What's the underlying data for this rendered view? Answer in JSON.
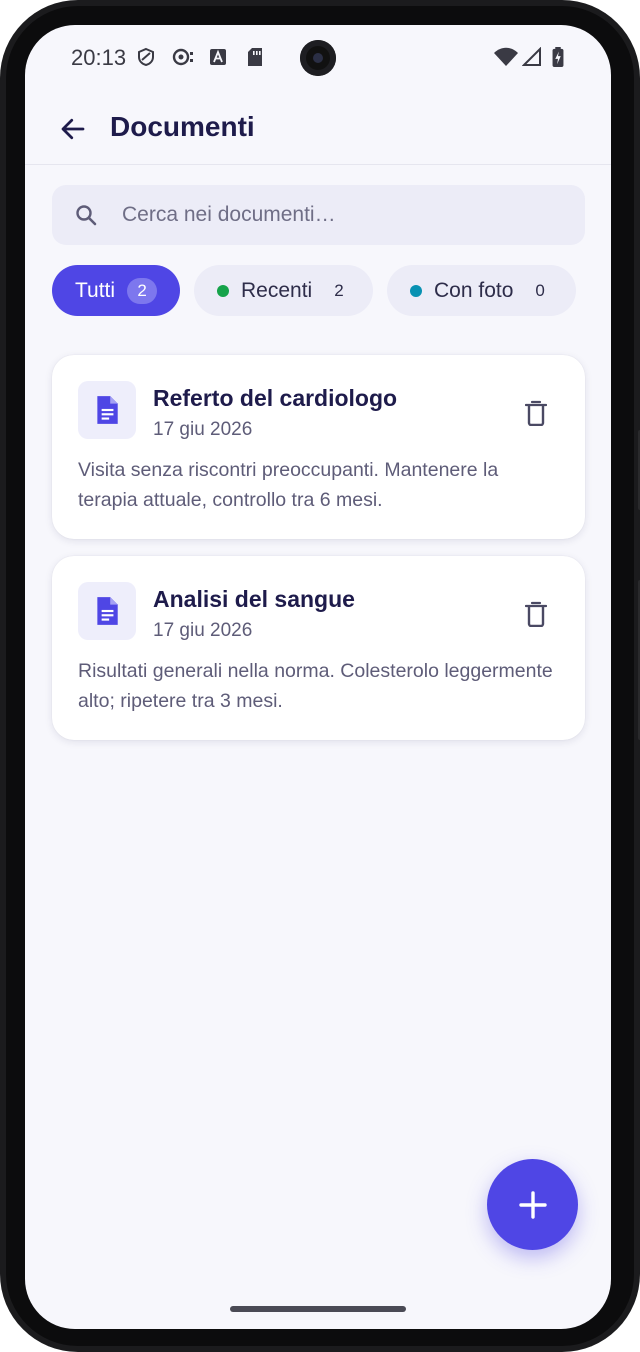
{
  "status_bar": {
    "time": "20:13",
    "icons": [
      "shield-icon",
      "tracking-icon",
      "keyboard-a-icon",
      "sd-card-icon",
      "wifi-icon",
      "signal-icon",
      "battery-charging-icon"
    ]
  },
  "appbar": {
    "title": "Documenti",
    "back_icon": "arrow-left-icon"
  },
  "search": {
    "placeholder": "Cerca nei documenti…",
    "value": "",
    "icon": "search-icon"
  },
  "filters": [
    {
      "label": "Tutti",
      "count": "2",
      "selected": true
    },
    {
      "label": "Recenti",
      "count": "2",
      "selected": false,
      "dot_color": "#16a34a"
    },
    {
      "label": "Con foto",
      "count": "0",
      "selected": false,
      "dot_color": "#0891b2"
    }
  ],
  "documents": [
    {
      "title": "Referto del cardiologo",
      "date": "17 giu 2026",
      "description": "Visita senza riscontri preoccupanti. Mantenere la terapia attuale, controllo tra 6 mesi.",
      "icon": "document-icon",
      "action_icon": "trash-icon"
    },
    {
      "title": "Analisi del sangue",
      "date": "17 giu 2026",
      "description": "Risultati generali nella norma. Colesterolo leggermente alto; ripetere tra 3 mesi.",
      "icon": "document-icon",
      "action_icon": "trash-icon"
    }
  ],
  "fab": {
    "icon": "plus-icon"
  },
  "colors": {
    "accent": "#4f46e5",
    "background": "#f7f7fc",
    "title": "#1e1b4b",
    "muted_text": "#5e5c78",
    "chip_inactive": "#ececf7"
  }
}
